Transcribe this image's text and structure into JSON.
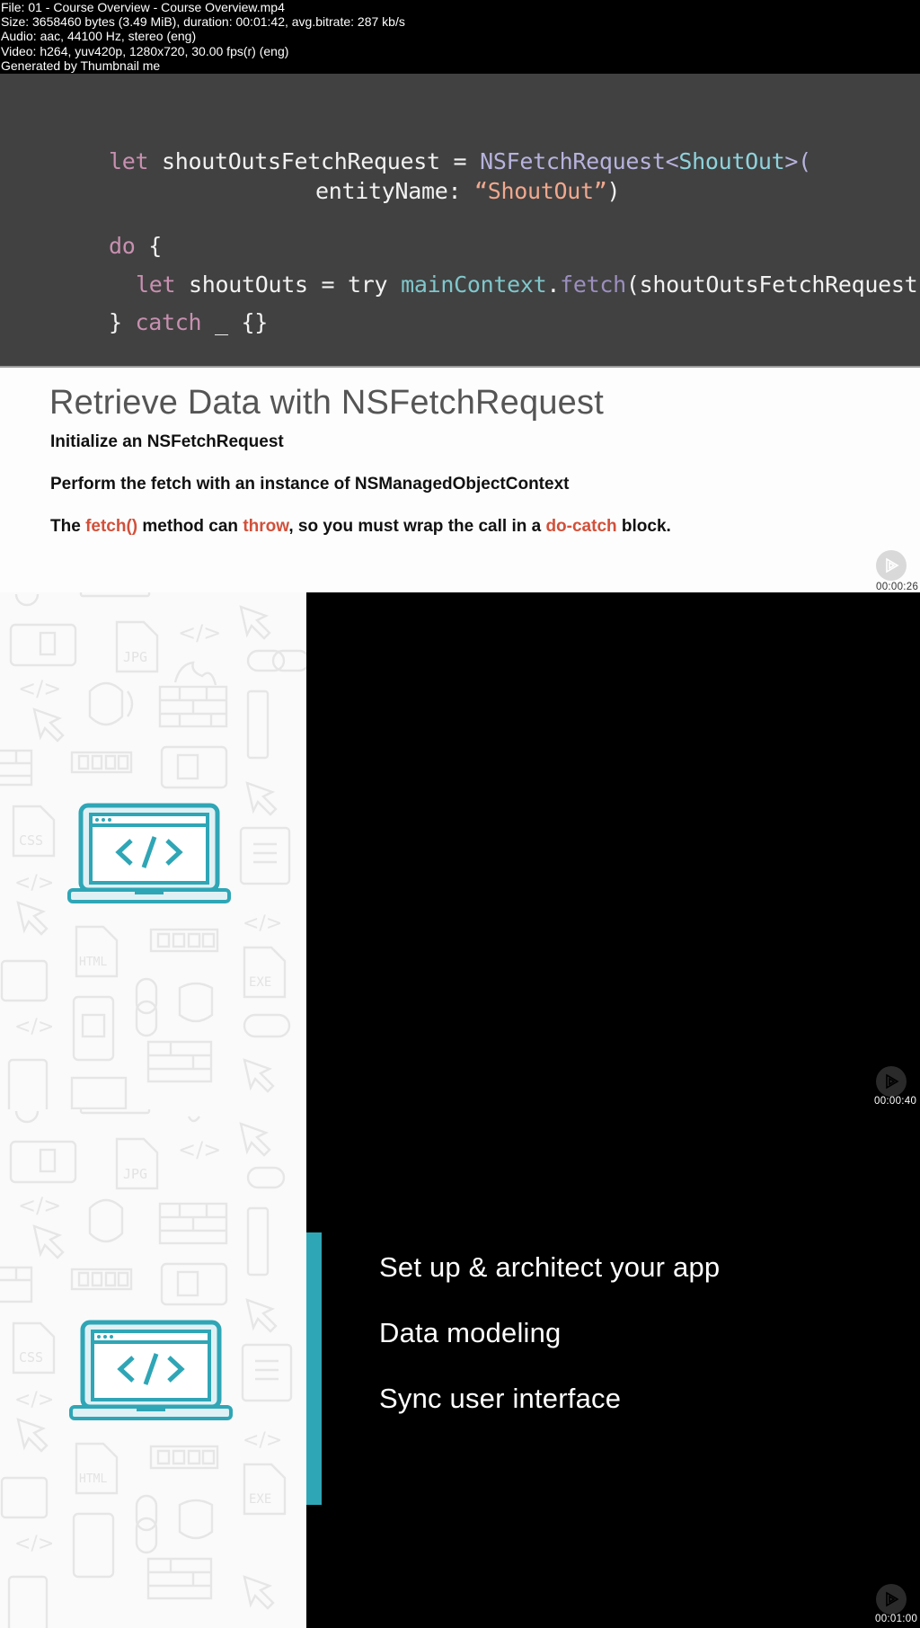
{
  "info": {
    "file": "File: 01 - Course Overview - Course Overview.mp4",
    "size": "Size: 3658460 bytes (3.49 MiB), duration: 00:01:42, avg.bitrate: 287 kb/s",
    "audio": "Audio: aac, 44100 Hz, stereo (eng)",
    "video": "Video: h264, yuv420p, 1280x720, 30.00 fps(r) (eng)",
    "generator": "Generated by Thumbnail me"
  },
  "frame1": {
    "code": {
      "line1": {
        "kw": "let",
        "var": " shoutOutsFetchRequest = ",
        "cls": "NSFetchRequest",
        "lt": "<",
        "typ": "ShoutOut",
        "gt": ">("
      },
      "line2": {
        "label": "entityName: ",
        "str": "“ShoutOut”",
        "close": ")"
      },
      "line3": {
        "kw": "do",
        "rest": " {"
      },
      "line4": {
        "kw": "let",
        "a": " shoutOuts = try ",
        "prop": "mainContext",
        "dot": ".",
        "mth": "fetch",
        "b": "(shoutOutsFetchRequest)"
      },
      "line5": {
        "open": "} ",
        "kw": "catch",
        "rest": " _ {}"
      }
    },
    "slide": {
      "title": "Retrieve Data with NSFetchRequest",
      "bullet1": "Initialize an NSFetchRequest",
      "bullet2": "Perform the fetch with an instance of NSManagedObjectContext",
      "bullet3": {
        "p1": "The ",
        "h1": "fetch()",
        "p2": " method can ",
        "h2": "throw",
        "p3": ", so you must wrap the call in a ",
        "h3": "do-catch",
        "p4": " block."
      }
    },
    "timestamp": "00:00:26"
  },
  "frame2": {
    "timestamp": "00:00:40"
  },
  "frame3": {
    "bullets": [
      "Set up & architect your app",
      "Data modeling",
      "Sync user interface"
    ],
    "timestamp": "00:01:00"
  },
  "colors": {
    "accent": "#2fa6b6",
    "highlight": "#d2503a",
    "code_bg": "#414141"
  }
}
